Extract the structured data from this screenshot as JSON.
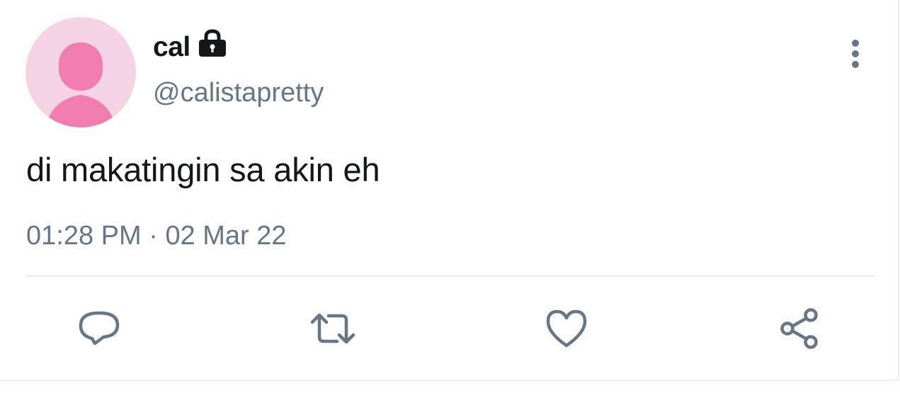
{
  "user": {
    "display_name": "cal",
    "handle": "@calistapretty",
    "protected": true,
    "avatar_color": "#f4d4e4",
    "avatar_silhouette_color": "#f07cb0"
  },
  "tweet": {
    "text": "di makatingin sa akin eh",
    "time": "01:28 PM",
    "separator": "·",
    "date": "02 Mar 22"
  },
  "actions": {
    "icons": [
      "comment-icon",
      "retweet-icon",
      "like-icon",
      "share-icon"
    ],
    "icon_color": "#657786"
  },
  "menu": {
    "icon": "more-vertical-icon"
  }
}
